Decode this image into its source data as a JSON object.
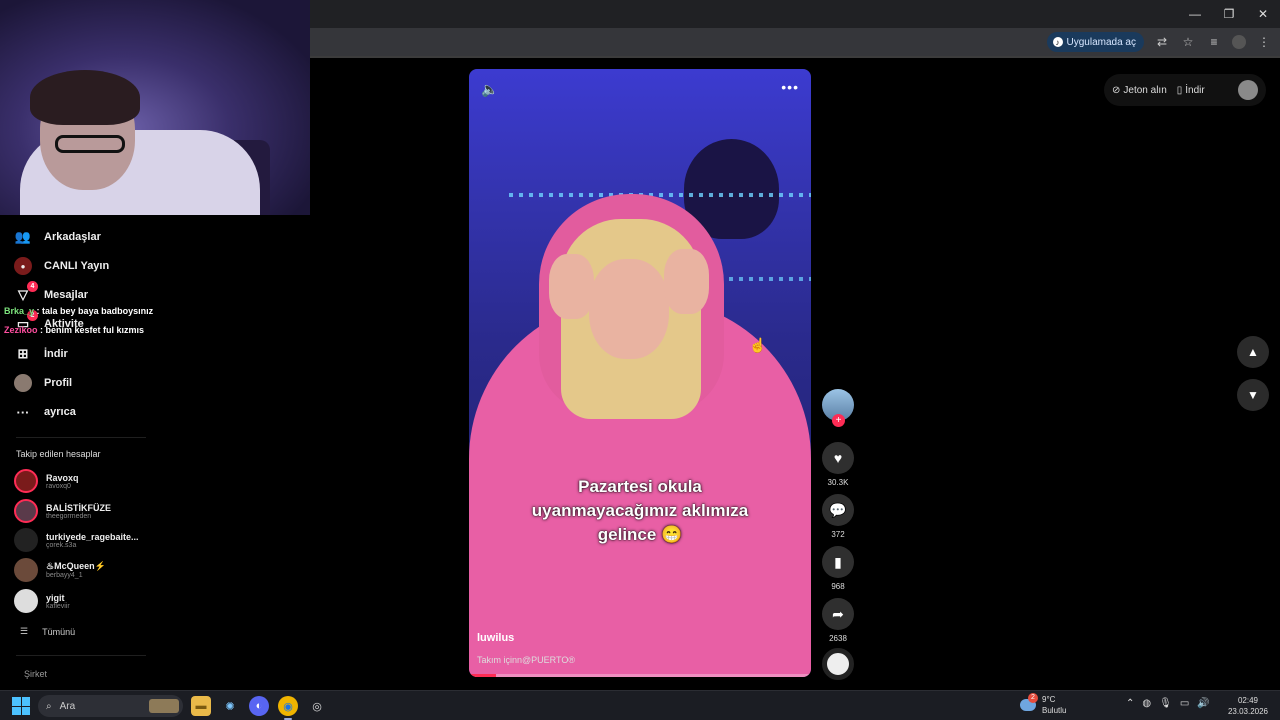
{
  "browser": {
    "open_in_app": "Uygulamada aç",
    "window_controls": [
      "—",
      "❐",
      "✕"
    ]
  },
  "sidebar": {
    "items": [
      {
        "label": "Arkadaşlar",
        "icon": "friends-icon"
      },
      {
        "label": "CANLI Yayın",
        "icon": "live-icon"
      },
      {
        "label": "Mesajlar",
        "icon": "messages-icon",
        "badge": "4"
      },
      {
        "label": "Aktivite",
        "icon": "activity-icon",
        "badge": "2"
      },
      {
        "label": "İndir",
        "icon": "download-icon"
      },
      {
        "label": "Profil",
        "icon": "profile-avatar"
      },
      {
        "label": "ayrıca",
        "icon": "more-icon"
      }
    ],
    "following_title": "Takip edilen hesaplar",
    "following": [
      {
        "name": "Ravoxq",
        "handle": "ravoxq0",
        "live": true
      },
      {
        "name": "BALİSTİKFÜZE",
        "handle": "theegormeden",
        "live": true
      },
      {
        "name": "turkiyede_ragebaite...",
        "handle": "çorek.s3a",
        "live": false
      },
      {
        "name": "♨McQueen⚡",
        "handle": "berbayy4_1",
        "live": false
      },
      {
        "name": "yigit",
        "handle": "kafleviir",
        "live": false
      }
    ],
    "see_all": "Tümünü",
    "company": "Şirket"
  },
  "chat": [
    {
      "user": "Brka_y",
      "message": ": tala bey baya badboysınız"
    },
    {
      "user": "Zezikoo",
      "message": ": benim kesfet ful kızmıs"
    }
  ],
  "video": {
    "caption_lines": [
      "Pazartesi okula",
      "uyanmayacağımız aklımıza",
      "gelince 😁"
    ],
    "author": "luwilus",
    "description": "Takım içinn@PUERTO®",
    "progress": 0.08
  },
  "actions": {
    "likes": "30.3K",
    "comments": "372",
    "saves": "968",
    "shares": "2638"
  },
  "top_right": {
    "coins": "Jeton alın",
    "download": "İndir"
  },
  "taskbar": {
    "search_placeholder": "Ara",
    "weather_temp": "9°C",
    "weather_desc": "Bulutlu",
    "weather_badge": "2",
    "time": "02:49",
    "date": "23.03.2026"
  }
}
